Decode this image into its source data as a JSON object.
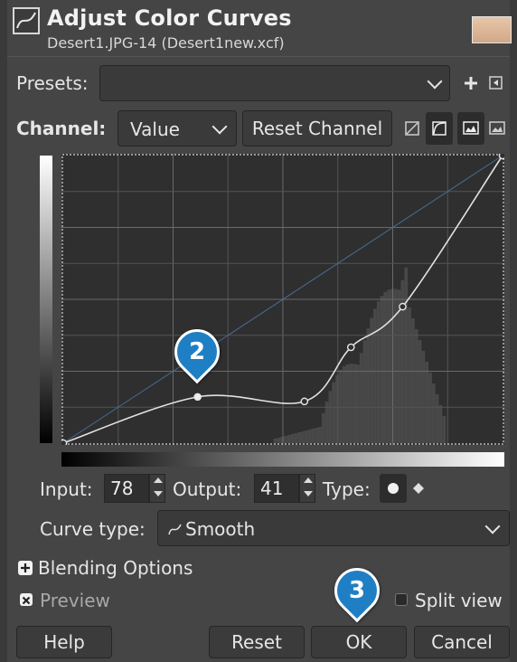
{
  "header": {
    "title": "Adjust Color Curves",
    "subtitle": "Desert1.JPG-14 (Desert1new.xcf)"
  },
  "presets": {
    "label": "Presets:",
    "value": ""
  },
  "channel": {
    "label": "Channel:",
    "value": "Value",
    "reset_label": "Reset Channel"
  },
  "io": {
    "input_label": "Input:",
    "input_value": "78",
    "output_label": "Output:",
    "output_value": "41",
    "type_label": "Type:"
  },
  "curve_type": {
    "label": "Curve type:",
    "value": "Smooth"
  },
  "blending": {
    "label": "Blending Options"
  },
  "preview": {
    "label": "Preview"
  },
  "split_view": {
    "label": "Split view"
  },
  "badges": {
    "b2": "2",
    "b3": "3"
  },
  "buttons": {
    "help": "Help",
    "reset": "Reset",
    "ok": "OK",
    "cancel": "Cancel"
  },
  "curve": {
    "control_points": [
      [
        0,
        0
      ],
      [
        78,
        41
      ],
      [
        140,
        37
      ],
      [
        167,
        85
      ],
      [
        197,
        121
      ],
      [
        255,
        255
      ]
    ],
    "selected_point": [
      78,
      41
    ]
  },
  "colors": {
    "accent_badge": "#1f7fc4",
    "curve_line": "#e0e0e0",
    "background": "#454545"
  },
  "icons": {
    "curve_app_icon": "curve-icon",
    "add_preset": "plus-icon",
    "preset_menu": "menu-arrow-icon",
    "linear_histogram": "linear-histogram-icon",
    "log_histogram": "log-histogram-icon",
    "view_histogram": "histogram-view-icon",
    "view_image": "image-view-icon",
    "point_smooth": "smooth-point-icon",
    "point_corner": "corner-point-icon",
    "curve_smooth": "smooth-curve-icon"
  }
}
